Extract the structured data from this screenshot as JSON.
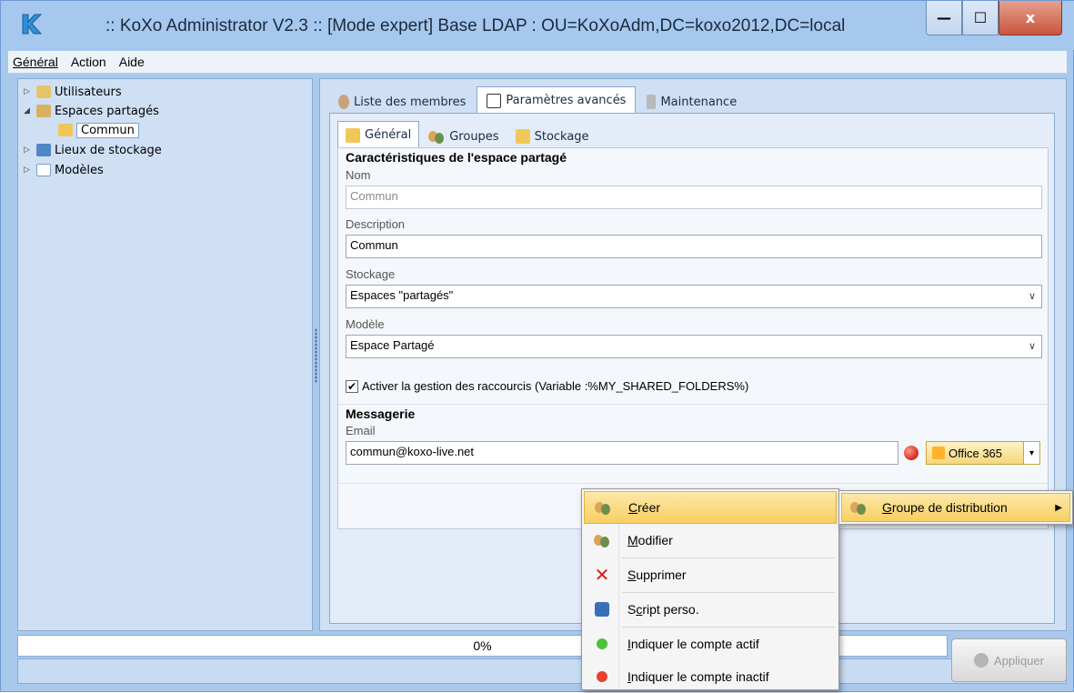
{
  "window": {
    "title": ":: KoXo Administrator V2.3 :: [Mode expert] Base LDAP : OU=KoXoAdm,DC=koxo2012,DC=local",
    "minimize": "—",
    "maximize": "☐",
    "close": "x"
  },
  "menu": {
    "items": [
      {
        "label": "Général"
      },
      {
        "label": "Action"
      },
      {
        "label": "Aide"
      }
    ]
  },
  "tree": {
    "items": [
      {
        "label": "Utilisateurs"
      },
      {
        "label": "Espaces partagés"
      },
      {
        "label": "Commun"
      },
      {
        "label": "Lieux de stockage"
      },
      {
        "label": "Modèles"
      }
    ]
  },
  "tabs": [
    {
      "label": "Liste des membres"
    },
    {
      "label": "Paramètres avancés"
    },
    {
      "label": "Maintenance"
    }
  ],
  "subtabs": [
    {
      "label": "Général"
    },
    {
      "label": "Groupes"
    },
    {
      "label": "Stockage"
    }
  ],
  "form": {
    "section_title": "Caractéristiques de l'espace partagé",
    "nom_label": "Nom",
    "nom_value": "Commun",
    "description_label": "Description",
    "description_value": "Commun",
    "stockage_label": "Stockage",
    "stockage_value": "Espaces \"partagés\"",
    "modele_label": "Modèle",
    "modele_value": "Espace Partagé",
    "shortcuts_checkbox": "Activer la gestion des raccourcis (Variable :%MY_SHARED_FOLDERS%)",
    "shortcuts_checked": true,
    "messagerie_title": "Messagerie",
    "email_label": "Email",
    "email_value": "commun@koxo-live.net",
    "provider_button": "Office 365"
  },
  "status": {
    "progress_text": "0%",
    "progress_value": 0,
    "apply_button": "Appliquer"
  },
  "context_menu": {
    "items": [
      {
        "label": "Créer",
        "accel": "C",
        "rest": "réer"
      },
      {
        "label": "Modifier",
        "accel": "M",
        "rest": "odifier"
      },
      {
        "label": "Supprimer",
        "accel": "S",
        "rest": "upprimer"
      },
      {
        "label": "Script perso.",
        "pre": "S",
        "accel": "c",
        "rest": "ript perso."
      },
      {
        "label": "Indiquer le compte actif",
        "accel": "I",
        "rest": "ndiquer le compte actif"
      },
      {
        "label": "Indiquer le compte inactif",
        "accel": "I",
        "rest": "ndiquer le compte inactif"
      }
    ],
    "submenu": {
      "label": "Groupe de distribution",
      "accel": "G",
      "rest": "roupe de distribution"
    }
  },
  "colors": {
    "titlebar": "#a6c8ee",
    "panel": "#cfe0f4",
    "menu_highlight": "#f7cf62",
    "close_button": "#c8553d"
  }
}
